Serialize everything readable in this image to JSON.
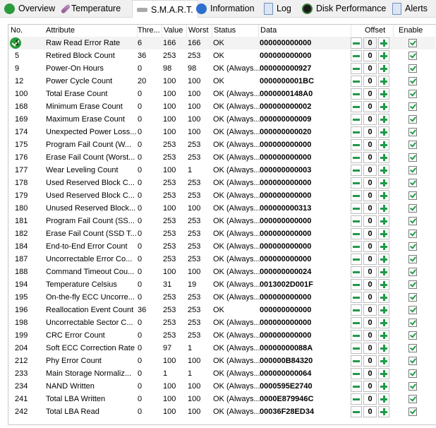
{
  "tabs": [
    {
      "label": "Overview",
      "icon": "check-circle-icon"
    },
    {
      "label": "Temperature",
      "icon": "thermometer-icon"
    },
    {
      "label": "S.M.A.R.T.",
      "icon": "drive-icon"
    },
    {
      "label": "Information",
      "icon": "info-icon"
    },
    {
      "label": "Log",
      "icon": "document-icon"
    },
    {
      "label": "Disk Performance",
      "icon": "gauge-icon"
    },
    {
      "label": "Alerts",
      "icon": "alerts-icon"
    }
  ],
  "columns": {
    "no": "No.",
    "attribute": "Attribute",
    "threshold": "Thre...",
    "value": "Value",
    "worst": "Worst",
    "status": "Status",
    "data": "Data",
    "offset": "Offset",
    "enable": "Enable"
  },
  "colors": {
    "accent": "#1f9a48"
  },
  "rows": [
    [
      "1",
      "Raw Read Error Rate",
      "6",
      "166",
      "166",
      "OK",
      "000000000000"
    ],
    [
      "5",
      "Retired Block Count",
      "36",
      "253",
      "253",
      "OK",
      "000000000000"
    ],
    [
      "9",
      "Power-On Hours",
      "0",
      "98",
      "98",
      "OK (Always...",
      "000000000927"
    ],
    [
      "12",
      "Power Cycle Count",
      "20",
      "100",
      "100",
      "OK",
      "0000000001BC"
    ],
    [
      "100",
      "Total Erase Count",
      "0",
      "100",
      "100",
      "OK (Always...",
      "0000000148A0"
    ],
    [
      "168",
      "Minimum Erase Count",
      "0",
      "100",
      "100",
      "OK (Always...",
      "000000000002"
    ],
    [
      "169",
      "Maximum Erase Count",
      "0",
      "100",
      "100",
      "OK (Always...",
      "000000000009"
    ],
    [
      "174",
      "Unexpected Power Loss...",
      "0",
      "100",
      "100",
      "OK (Always...",
      "000000000020"
    ],
    [
      "175",
      "Program Fail Count (W...",
      "0",
      "253",
      "253",
      "OK (Always...",
      "000000000000"
    ],
    [
      "176",
      "Erase Fail Count (Worst...",
      "0",
      "253",
      "253",
      "OK (Always...",
      "000000000000"
    ],
    [
      "177",
      "Wear Leveling Count",
      "0",
      "100",
      "1",
      "OK (Always...",
      "000000000003"
    ],
    [
      "178",
      "Used Reserved Block C...",
      "0",
      "253",
      "253",
      "OK (Always...",
      "000000000000"
    ],
    [
      "179",
      "Used Reserved Block C...",
      "0",
      "253",
      "253",
      "OK (Always...",
      "000000000000"
    ],
    [
      "180",
      "Unused Reserved Block...",
      "0",
      "100",
      "100",
      "OK (Always...",
      "000000000313"
    ],
    [
      "181",
      "Program Fail Count (SS...",
      "0",
      "253",
      "253",
      "OK (Always...",
      "000000000000"
    ],
    [
      "182",
      "Erase Fail Count (SSD T...",
      "0",
      "253",
      "253",
      "OK (Always...",
      "000000000000"
    ],
    [
      "184",
      "End-to-End Error Count",
      "0",
      "253",
      "253",
      "OK (Always...",
      "000000000000"
    ],
    [
      "187",
      "Uncorrectable Error Co...",
      "0",
      "253",
      "253",
      "OK (Always...",
      "000000000000"
    ],
    [
      "188",
      "Command Timeout Cou...",
      "0",
      "100",
      "100",
      "OK (Always...",
      "000000000024"
    ],
    [
      "194",
      "Temperature Celsius",
      "0",
      "31",
      "19",
      "OK (Always...",
      "0013002D001F"
    ],
    [
      "195",
      "On-the-fly ECC Uncorre...",
      "0",
      "253",
      "253",
      "OK (Always...",
      "000000000000"
    ],
    [
      "196",
      "Reallocation Event Count",
      "36",
      "253",
      "253",
      "OK",
      "000000000000"
    ],
    [
      "198",
      "Uncorrectable Sector C...",
      "0",
      "253",
      "253",
      "OK (Always...",
      "000000000000"
    ],
    [
      "199",
      "CRC Error Count",
      "0",
      "253",
      "253",
      "OK (Always...",
      "000000000000"
    ],
    [
      "204",
      "Soft ECC Correction Rate",
      "0",
      "97",
      "1",
      "OK (Always...",
      "00000000088A"
    ],
    [
      "212",
      "Phy Error Count",
      "0",
      "100",
      "100",
      "OK (Always...",
      "000000B84320"
    ],
    [
      "233",
      "Main Storage Normaliz...",
      "0",
      "1",
      "1",
      "OK (Always...",
      "000000000064"
    ],
    [
      "234",
      "NAND Written",
      "0",
      "100",
      "100",
      "OK (Always...",
      "0000595E2740"
    ],
    [
      "241",
      "Total LBA Written",
      "0",
      "100",
      "100",
      "OK (Always...",
      "0000E879946C"
    ],
    [
      "242",
      "Total LBA Read",
      "0",
      "100",
      "100",
      "OK (Always...",
      "00036F28ED34"
    ]
  ],
  "offset_value": "0",
  "enabled": true
}
